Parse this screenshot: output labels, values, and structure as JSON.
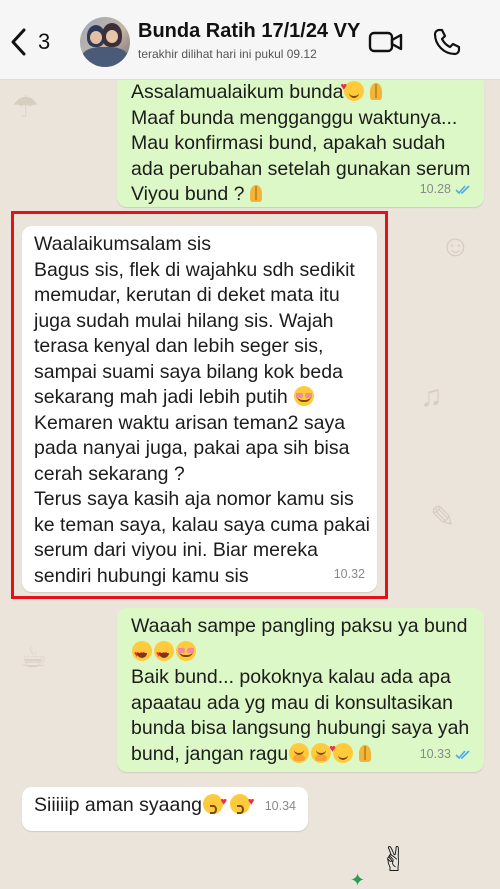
{
  "header": {
    "back_count": "3",
    "contact_name": "Bunda Ratih 17/1/24 VY",
    "status": "terakhir dilihat hari ini pukul 09.12"
  },
  "messages": [
    {
      "direction": "outgoing",
      "lines": [
        "Assalamualaikum bunda",
        "Maaf bunda mengganggu waktunya...",
        "Mau konfirmasi bund, apakah sudah",
        "ada perubahan setelah gunakan serum",
        "Viyou bund ?"
      ],
      "time": "10.28",
      "read": true
    },
    {
      "direction": "incoming",
      "lines": [
        "Waalaikumsalam sis",
        "Bagus sis, flek di wajahku sdh sedikit",
        "memudar, kerutan di deket mata itu",
        "juga sudah mulai hilang sis. Wajah",
        "terasa kenyal dan lebih seger sis,",
        "sampai suami saya bilang kok beda",
        "sekarang mah jadi lebih putih",
        "Kemaren waktu arisan teman2 saya",
        "pada nanyai juga, pakai apa sih bisa",
        "cerah sekarang ?",
        "Terus saya kasih aja nomor kamu sis",
        "ke teman saya, kalau saya cuma pakai",
        "serum dari viyou ini. Biar mereka",
        "sendiri hubungi kamu sis"
      ],
      "time": "10.32",
      "highlighted": true
    },
    {
      "direction": "outgoing",
      "lines": [
        "Waaah sampe pangling paksu ya bund",
        "",
        "Baik bund... pokoknya kalau ada apa",
        "apaatau ada yg mau di konsultasikan",
        "bunda bisa langsung hubungi saya yah",
        "bund, jangan ragu"
      ],
      "time": "10.33",
      "read": true
    },
    {
      "direction": "incoming",
      "lines": [
        "Siiiiip aman syaang"
      ],
      "time": "10.34"
    }
  ],
  "colors": {
    "outgoing_bubble": "#dcf8c6",
    "incoming_bubble": "#ffffff",
    "background": "#ebe4db",
    "highlight_border": "#e0131b",
    "read_ticks": "#4fa9e8"
  },
  "icons": {
    "back": "chevron-left-icon",
    "video": "video-camera-icon",
    "call": "phone-icon",
    "read_receipt": "double-check-icon"
  }
}
